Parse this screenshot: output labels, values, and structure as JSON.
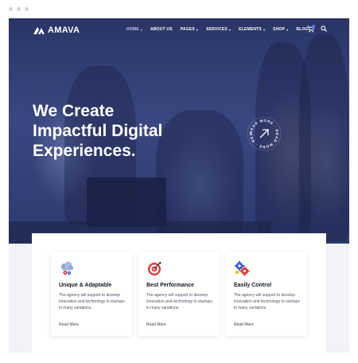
{
  "brand": {
    "name": "AMAVA"
  },
  "nav": {
    "items": [
      {
        "label": "HOME",
        "dropdown": true,
        "active": true
      },
      {
        "label": "ABOUT US",
        "dropdown": false,
        "active": false
      },
      {
        "label": "PAGES",
        "dropdown": true,
        "active": false
      },
      {
        "label": "SERVICES",
        "dropdown": true,
        "active": false
      },
      {
        "label": "ELEMENTS",
        "dropdown": true,
        "active": false
      },
      {
        "label": "SHOP",
        "dropdown": true,
        "active": false
      },
      {
        "label": "BLOG",
        "dropdown": true,
        "active": false
      }
    ],
    "cart_icon": "cart-icon",
    "search_icon": "search-icon"
  },
  "hero": {
    "headline_lines": [
      "We Create",
      "Impactful Digital",
      "Experiences."
    ],
    "badge_text": "READ MORE · READ MORE · READ MORE ·"
  },
  "features": [
    {
      "icon": "cloud-gears-icon",
      "title": "Unique & Adaptable",
      "description": "The agency will support to develop innovation and technology to startups in many variations.",
      "link": "Read More"
    },
    {
      "icon": "target-icon",
      "title": "Best Performance",
      "description": "The agency will support to develop innovation and technology to startups in many variations.",
      "link": "Read More"
    },
    {
      "icon": "gears-icon",
      "title": "Easily Control",
      "description": "The agency will support to develop innovation and technology to startups in many variations.",
      "link": "Read More"
    }
  ],
  "colors": {
    "hero_overlay": "#2e3a6e",
    "accent_blue": "#3b82f6",
    "accent_red": "#e53935",
    "page_bg": "#f2f3f6"
  }
}
